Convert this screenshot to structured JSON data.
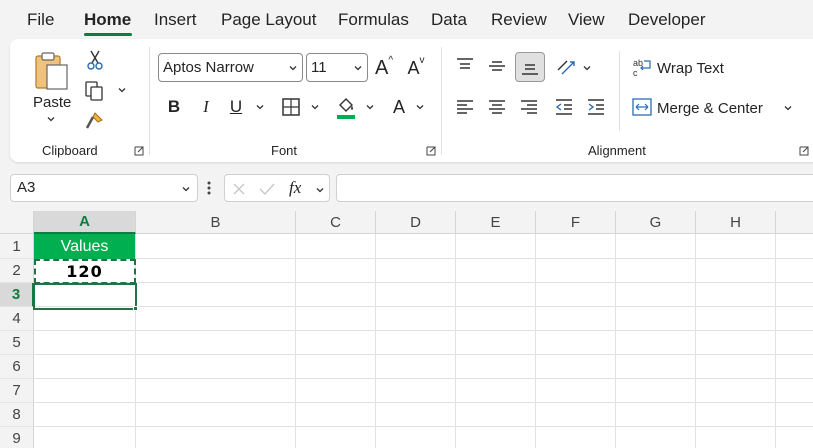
{
  "tabs": [
    {
      "label": "File"
    },
    {
      "label": "Home"
    },
    {
      "label": "Insert"
    },
    {
      "label": "Page Layout"
    },
    {
      "label": "Formulas"
    },
    {
      "label": "Data"
    },
    {
      "label": "Review"
    },
    {
      "label": "View"
    },
    {
      "label": "Developer"
    }
  ],
  "active_tab": "Home",
  "ribbon": {
    "clipboard": {
      "label": "Clipboard",
      "paste_label": "Paste"
    },
    "font": {
      "label": "Font",
      "font_name": "Aptos Narrow",
      "font_size": "11",
      "grow_glyph": "A",
      "shrink_glyph": "A",
      "bold": "B",
      "italic": "I",
      "underline": "U",
      "font_color_glyph": "A"
    },
    "alignment": {
      "label": "Alignment",
      "wrap_text": "Wrap Text",
      "merge_center": "Merge & Center"
    }
  },
  "formula_bar": {
    "name_box": "A3",
    "fx": "fx",
    "formula": ""
  },
  "columns": [
    "A",
    "B",
    "C",
    "D",
    "E",
    "F",
    "G",
    "H"
  ],
  "rows": [
    "1",
    "2",
    "3",
    "4",
    "5",
    "6",
    "7",
    "8",
    "9"
  ],
  "cells": {
    "A1": "Values",
    "A2": "120"
  },
  "selected_cell": "A3",
  "colors": {
    "accent": "#107c41",
    "header_fill": "#00b050",
    "font_color_bar": "#00b050",
    "fill_color_bar": "#ffc000"
  }
}
